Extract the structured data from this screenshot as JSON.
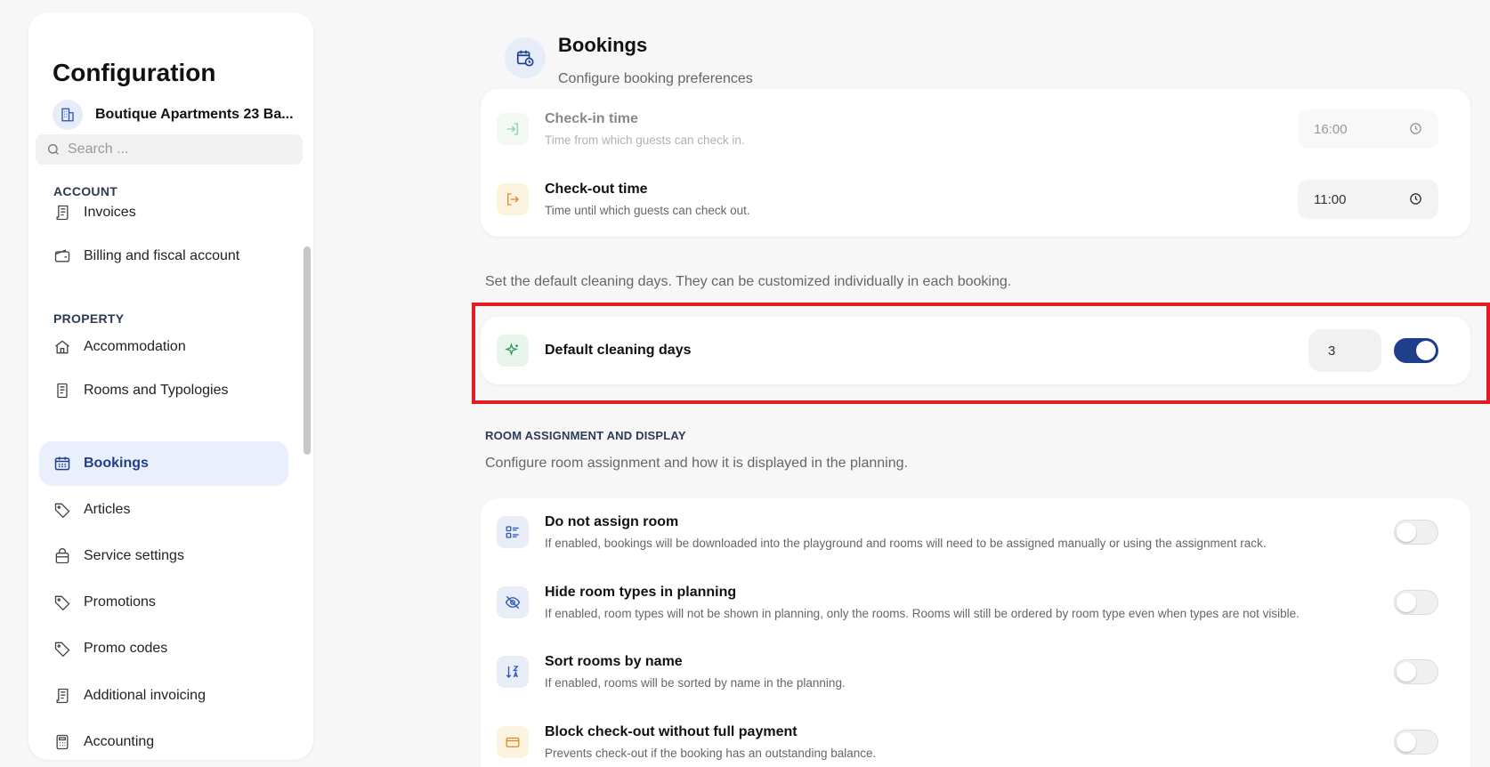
{
  "sidebar": {
    "title": "Configuration",
    "property_name": "Boutique Apartments 23 Ba...",
    "search_placeholder": "Search ...",
    "sections": {
      "account": "ACCOUNT",
      "property": "PROPERTY"
    },
    "items": [
      {
        "label": "Invoices",
        "icon": "receipt-icon"
      },
      {
        "label": "Billing and fiscal account",
        "icon": "wallet-icon"
      },
      {
        "label": "Accommodation",
        "icon": "home-icon"
      },
      {
        "label": "Rooms and Typologies",
        "icon": "document-icon"
      },
      {
        "label": "Bookings",
        "icon": "calendar-grid-icon",
        "active": true
      },
      {
        "label": "Articles",
        "icon": "tag-icon"
      },
      {
        "label": "Service settings",
        "icon": "bag-icon"
      },
      {
        "label": "Promotions",
        "icon": "tag-icon"
      },
      {
        "label": "Promo codes",
        "icon": "tag-icon"
      },
      {
        "label": "Additional invoicing",
        "icon": "receipt-icon"
      },
      {
        "label": "Accounting",
        "icon": "calculator-icon"
      }
    ]
  },
  "header": {
    "title": "Bookings",
    "subtitle": "Configure booking preferences"
  },
  "times": [
    {
      "title": "Check-in time",
      "desc": "Time from which guests can check in.",
      "value": "16:00"
    },
    {
      "title": "Check-out time",
      "desc": "Time until which guests can check out.",
      "value": "11:00"
    }
  ],
  "cleaning": {
    "help": "Set the default cleaning days. They can be customized individually in each booking.",
    "title": "Default cleaning days",
    "value": "3",
    "enabled": true
  },
  "room_assignment": {
    "section_title": "ROOM ASSIGNMENT AND DISPLAY",
    "help": "Configure room assignment and how it is displayed in the planning.",
    "rows": [
      {
        "title": "Do not assign room",
        "desc": "If enabled, bookings will be downloaded into the playground and rooms will need to be assigned manually or using the assignment rack.",
        "enabled": false
      },
      {
        "title": "Hide room types in planning",
        "desc": "If enabled, room types will not be shown in planning, only the rooms. Rooms will still be ordered by room type even when types are not visible.",
        "enabled": false
      },
      {
        "title": "Sort rooms by name",
        "desc": "If enabled, rooms will be sorted by name in the planning.",
        "enabled": false
      },
      {
        "title": "Block check-out without full payment",
        "desc": "Prevents check-out if the booking has an outstanding balance.",
        "enabled": false
      }
    ]
  },
  "colors": {
    "accent": "#1f3f8c",
    "highlight": "#e31b23"
  }
}
